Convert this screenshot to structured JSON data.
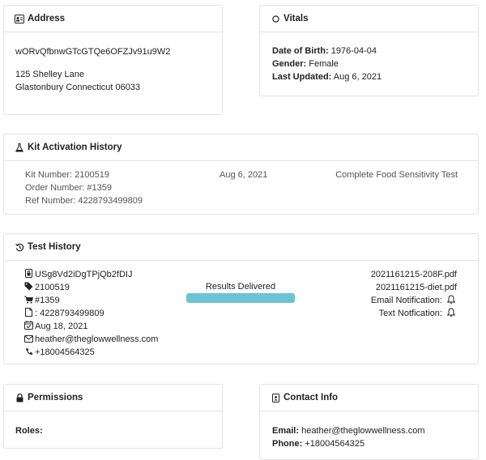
{
  "address": {
    "title": "Address",
    "icon": "address-card-icon",
    "id_code": "wORvQfbnwGTcGTQe6OFZJv91u9W2",
    "street": "125 Shelley Lane",
    "city_line": "Glastonbury Connecticut 06033"
  },
  "vitals": {
    "title": "Vitals",
    "icon": "circle-icon",
    "dob_label": "Date of Birth:",
    "dob": "1976-04-04",
    "gender_label": "Gender:",
    "gender": "Female",
    "updated_label": "Last Updated:",
    "updated": "Aug 6, 2021"
  },
  "kit": {
    "title": "Kit Activation History",
    "icon": "flask-icon",
    "kit_number": "Kit Number: 2100519",
    "order_number": "Order Number: #1359",
    "ref_number": "Ref Number: 4228793499809",
    "date": "Aug 6, 2021",
    "test_name": "Complete Food Sensitivity Test"
  },
  "test_history": {
    "title": "Test History",
    "icon": "history-icon",
    "code": "USg8Vd2iDgTPjQb2fDIJ",
    "kit": "2100519",
    "order": "#1359",
    "ref": ": 4228793499809",
    "date": "Aug 18, 2021",
    "email": "heather@theglowwellness.com",
    "phone": "+18004564325",
    "status": "Results Delivered",
    "progress_fraction": 1.0,
    "file1": "2021161215-208F.pdf",
    "file2": "2021161215-diet.pdf",
    "email_notification": "Email Notification:",
    "text_notification": "Text Notfication:",
    "accent_color": "#6cc3d3"
  },
  "permissions": {
    "title": "Permissions",
    "icon": "lock-icon",
    "roles_label": "Roles:"
  },
  "contact": {
    "title": "Contact Info",
    "icon": "id-badge-icon",
    "email_label": "Email:",
    "email": "heather@theglowwellness.com",
    "phone_label": "Phone:",
    "phone": "+18004564325"
  }
}
